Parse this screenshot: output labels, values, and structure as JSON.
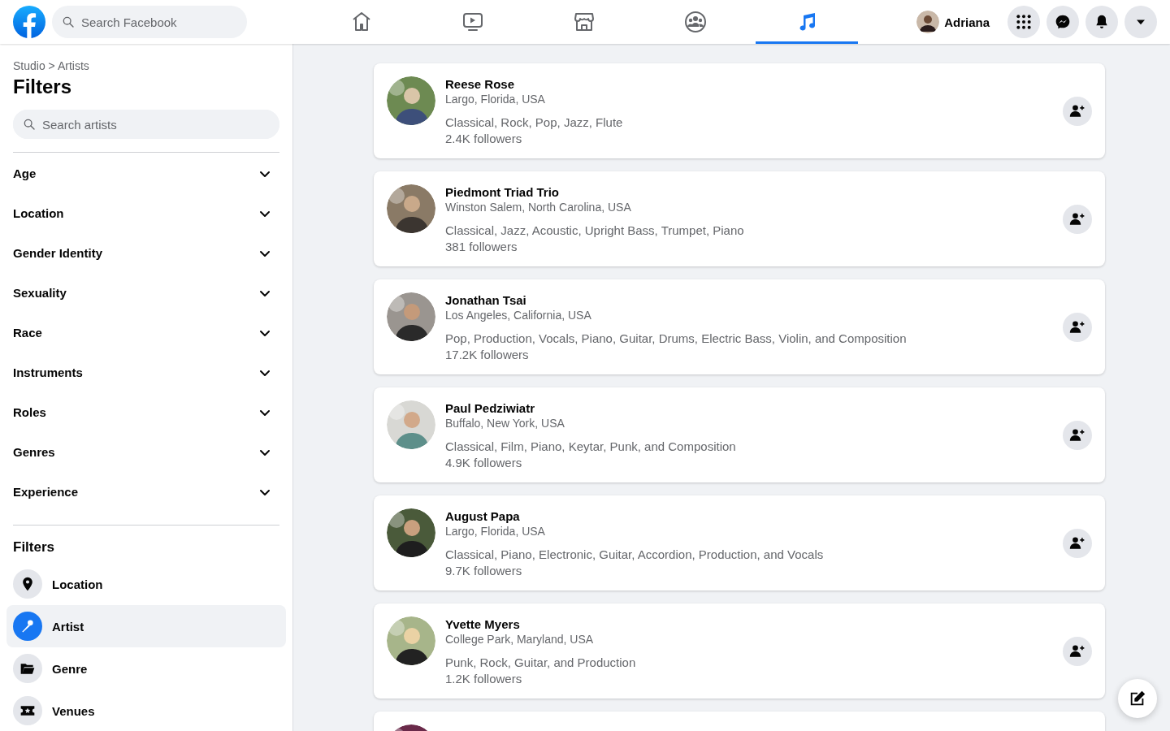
{
  "topbar": {
    "search": {
      "placeholder": "Search Facebook"
    },
    "nav_tabs": [
      {
        "kind": "home",
        "selected": false
      },
      {
        "kind": "video",
        "selected": false
      },
      {
        "kind": "store",
        "selected": false
      },
      {
        "kind": "groups",
        "selected": false
      },
      {
        "kind": "music",
        "selected": true
      }
    ],
    "profile": {
      "name": "Adriana"
    },
    "buttons": [
      {
        "kind": "apps"
      },
      {
        "kind": "messenger"
      },
      {
        "kind": "notifications"
      },
      {
        "kind": "account"
      }
    ]
  },
  "sidebar": {
    "breadcrumb": "Studio > Artists",
    "title": "Filters",
    "search": {
      "placeholder": "Search artists"
    },
    "filter_groups": [
      {
        "label": "Age",
        "expanded": false
      },
      {
        "label": "Location",
        "expanded": false
      },
      {
        "label": "Gender Identity",
        "expanded": false
      },
      {
        "label": "Sexuality",
        "expanded": false
      },
      {
        "label": "Race",
        "expanded": false
      },
      {
        "label": "Instruments",
        "expanded": false
      },
      {
        "label": "Roles",
        "expanded": false
      },
      {
        "label": "Genres",
        "expanded": false
      },
      {
        "label": "Experience",
        "expanded": false
      }
    ],
    "section_title": "Filters",
    "categories": [
      {
        "kind": "location",
        "label": "Location",
        "selected": false
      },
      {
        "kind": "artist",
        "label": "Artist",
        "selected": true
      },
      {
        "kind": "genre",
        "label": "Genre",
        "selected": false
      },
      {
        "kind": "venues",
        "label": "Venues",
        "selected": false
      }
    ]
  },
  "artists": [
    {
      "name": "Reese Rose",
      "location": "Largo, Florida, USA",
      "tags": "Classical, Rock, Pop, Jazz, Flute",
      "followers": "2.4K followers"
    },
    {
      "name": "Piedmont Triad Trio",
      "location": "Winston Salem, North Carolina, USA",
      "tags": "Classical, Jazz, Acoustic, Upright Bass, Trumpet, Piano",
      "followers": "381 followers"
    },
    {
      "name": "Jonathan Tsai",
      "location": "Los Angeles, California, USA",
      "tags": "Pop, Production, Vocals, Piano, Guitar, Drums, Electric Bass, Violin, and Composition",
      "followers": "17.2K followers"
    },
    {
      "name": "Paul Pedziwiatr",
      "location": "Buffalo, New York, USA",
      "tags": "Classical, Film, Piano, Keytar, Punk, and Composition",
      "followers": "4.9K followers"
    },
    {
      "name": "August Papa",
      "location": "Largo, Florida, USA",
      "tags": "Classical, Piano, Electronic, Guitar, Accordion, Production, and Vocals",
      "followers": "9.7K followers"
    },
    {
      "name": "Yvette Myers",
      "location": "College Park, Maryland, USA",
      "tags": "Punk, Rock, Guitar, and Production",
      "followers": "1.2K followers"
    },
    {
      "kind": "partial"
    }
  ]
}
